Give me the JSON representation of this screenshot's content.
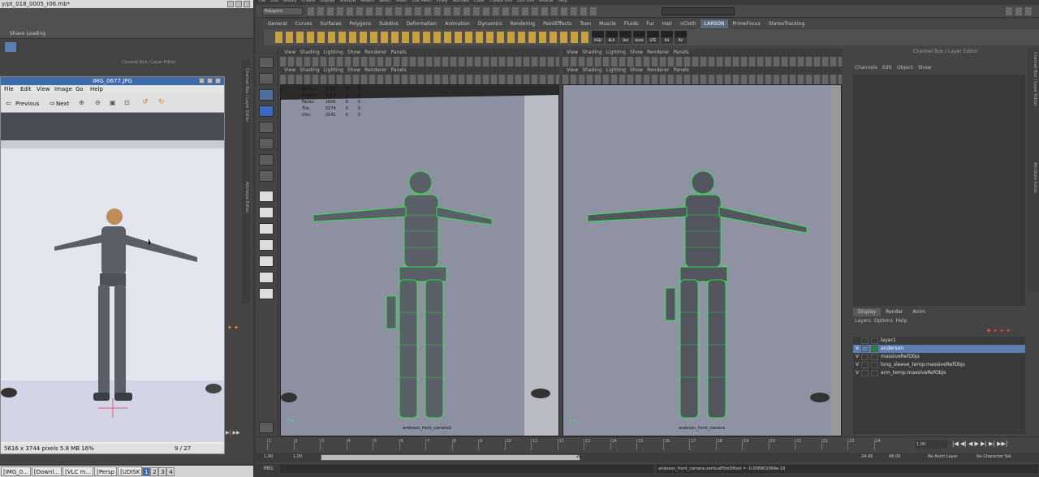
{
  "left_window": {
    "title": "y/pt_018_0005_r06.mb*",
    "tab_label": "Shave Loading",
    "side_label_1": "Channel Box / Layer Editor",
    "side_label_2": "Channel Box / Layer Editor",
    "side_label_3": "Attribute Editor",
    "channel_header": "Channel Box / Layer Editor"
  },
  "image_viewer": {
    "title": "IMG_0677.JPG",
    "menu": [
      "File",
      "Edit",
      "View",
      "Image",
      "Go",
      "Help"
    ],
    "prev_label": "Previous",
    "next_label": "Next",
    "status_left": "5616 x 3744 pixels  5.8 MB  16%",
    "status_right": "9 / 27"
  },
  "maya": {
    "mode_select": "Polygons",
    "menu_items": [
      "File",
      "Edit",
      "Modify",
      "Create",
      "Display",
      "Window",
      "Assets",
      "Select",
      "Mesh",
      "Edit Mesh",
      "Proxy",
      "Normals",
      "Color",
      "Create UVs",
      "Edit UVs",
      "Muscle",
      "Help"
    ],
    "shelf_tabs": [
      "General",
      "Curves",
      "Surfaces",
      "Polygons",
      "Subdivs",
      "Deformation",
      "Animation",
      "Dynamics",
      "Rendering",
      "PaintEffects",
      "Toon",
      "Muscle",
      "Fluids",
      "Fur",
      "Hair",
      "nCloth",
      "LARSON",
      "PrimeFocus",
      "StereoTracking"
    ],
    "active_shelf_tab": "LARSON",
    "shelf_buttons": [
      "RGD",
      "BLR",
      "Out",
      "Hshd",
      "UTE",
      "Rll",
      "RV"
    ],
    "viewport_menu": [
      "View",
      "Shading",
      "Lighting",
      "Show",
      "Renderer",
      "Panels"
    ],
    "hud": {
      "rows": [
        {
          "label": "Verts:",
          "a": "1723",
          "b": "0",
          "c": "0"
        },
        {
          "label": "Edges:",
          "a": "3462",
          "b": "0",
          "c": "0"
        },
        {
          "label": "Faces:",
          "a": "1600",
          "b": "0",
          "c": "0"
        },
        {
          "label": "Tris:",
          "a": "3274",
          "b": "0",
          "c": "0"
        },
        {
          "label": "UVs:",
          "a": "2541",
          "b": "0",
          "c": "0"
        }
      ]
    },
    "viewport_left_camera": "andoson_front_camera1",
    "viewport_right_camera": "andoson_front_camera",
    "channel_box": {
      "title": "Channel Box / Layer Editor",
      "menu": [
        "Channels",
        "Edit",
        "Object",
        "Show"
      ]
    },
    "layer_editor": {
      "tabs": [
        "Display",
        "Render",
        "Anim"
      ],
      "menu": [
        "Layers",
        "Options",
        "Help"
      ],
      "layers": [
        {
          "vis": "",
          "name": "layer1",
          "selected": false
        },
        {
          "vis": "V",
          "name": "anderson",
          "selected": true
        },
        {
          "vis": "V",
          "name": "massiveRefObjs",
          "selected": false
        },
        {
          "vis": "V",
          "name": "long_sleeve_temp:massiveRefObjs",
          "selected": false
        },
        {
          "vis": "V",
          "name": "arm_temp:massiveRefObjs",
          "selected": false
        }
      ]
    },
    "timeline": {
      "ticks": [
        "1",
        "2",
        "3",
        "4",
        "5",
        "6",
        "7",
        "8",
        "9",
        "10",
        "11",
        "12",
        "13",
        "14",
        "15",
        "16",
        "17",
        "18",
        "19",
        "20",
        "21",
        "22",
        "23",
        "24"
      ],
      "current_frame": "1.00",
      "start": "1.00",
      "start2": "1.00",
      "range_mid": "24",
      "end": "24.00",
      "end2": "48.00",
      "anim_layer": "No Anim Layer",
      "char_set": "No Character Set"
    },
    "command": {
      "label": "MEL",
      "result": "andoson_front_camera.verticalFilmOffset = -0.006802064e-18"
    }
  },
  "taskbar": {
    "tasks": [
      "[IMG_0...",
      "[Downl...",
      "[VLC m...",
      "[Persp",
      "[UDISK"
    ],
    "workspaces": [
      "1",
      "2",
      "3",
      "4"
    ],
    "active_workspace": "1"
  },
  "colors": {
    "wireframe": "#22ff44",
    "selection": "#5a7fb0",
    "viewer_title": "#3d6aa8"
  }
}
